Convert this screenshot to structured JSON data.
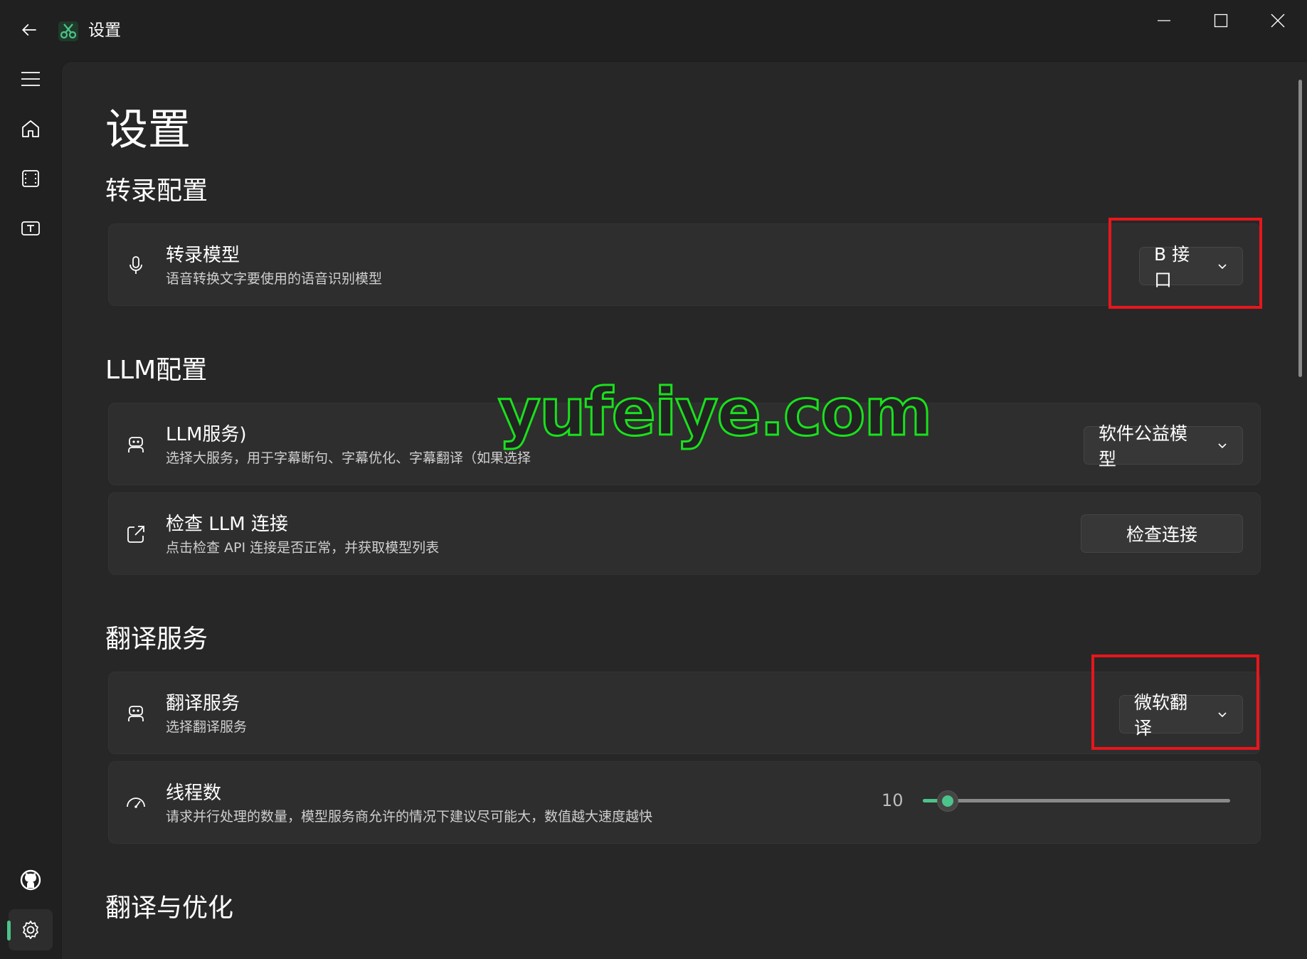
{
  "titlebar": {
    "title": "设置",
    "icons": {
      "back": "arrow-left-icon",
      "app": "scissors-app-icon",
      "minimize": "minimize-icon",
      "maximize": "maximize-icon",
      "close": "close-icon"
    }
  },
  "nav": {
    "items": [
      "menu-icon",
      "home-icon",
      "film-icon",
      "subtitle-icon"
    ],
    "bottom": [
      "github-icon",
      "gear-icon"
    ],
    "accent": "#4cc38a"
  },
  "page": {
    "title": "设置"
  },
  "sections": {
    "transcribe": {
      "title": "转录配置",
      "model": {
        "title": "转录模型",
        "subtitle": "语音转换文字要使用的语音识别模型",
        "value": "B 接口",
        "icon": "microphone-icon"
      }
    },
    "llm": {
      "title": "LLM配置",
      "service": {
        "title": "LLM服务)",
        "subtitle": "选择大服务，用于字幕断句、字幕优化、字幕翻译（如果选择",
        "value": "软件公益模型",
        "icon": "robot-icon"
      },
      "check": {
        "title": "检查 LLM 连接",
        "subtitle": "点击检查 API 连接是否正常，并获取模型列表",
        "button": "检查连接",
        "icon": "open-external-icon"
      }
    },
    "translate": {
      "title": "翻译服务",
      "service": {
        "title": "翻译服务",
        "subtitle": "选择翻译服务",
        "value": "微软翻译",
        "icon": "robot-icon"
      },
      "threads": {
        "title": "线程数",
        "subtitle": "请求并行处理的数量，模型服务商允许的情况下建议尽可能大，数值越大速度越快",
        "value": "10",
        "level": 0.08,
        "icon": "speedometer-icon"
      }
    },
    "optimize": {
      "title": "翻译与优化"
    }
  },
  "watermark": "yufeiye.com",
  "colors": {
    "highlight": "#e8161c",
    "accent": "#4cc38a",
    "watermark": "#19e11c"
  }
}
